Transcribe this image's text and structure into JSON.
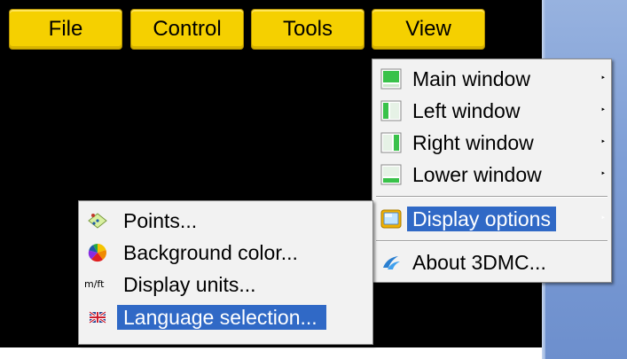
{
  "menubar": {
    "items": [
      {
        "label": "File"
      },
      {
        "label": "Control"
      },
      {
        "label": "Tools"
      },
      {
        "label": "View"
      }
    ]
  },
  "view_menu": {
    "items": [
      {
        "label": "Main window",
        "icon": "main-window-layout-icon",
        "submenu": true
      },
      {
        "label": "Left window",
        "icon": "left-window-layout-icon",
        "submenu": true
      },
      {
        "label": "Right window",
        "icon": "right-window-layout-icon",
        "submenu": true
      },
      {
        "label": "Lower window",
        "icon": "lower-window-layout-icon",
        "submenu": true
      },
      {
        "label": "Display options",
        "icon": "display-options-icon",
        "submenu": true,
        "highlighted": true
      },
      {
        "label": "About 3DMC...",
        "icon": "3dmc-logo-icon",
        "submenu": false
      }
    ],
    "submenu_arrow": "‣"
  },
  "display_options_menu": {
    "items": [
      {
        "label": "Points...",
        "icon": "points-icon"
      },
      {
        "label": "Background color...",
        "icon": "color-wheel-icon"
      },
      {
        "label": "Display units...",
        "icon": "units-icon",
        "icon_text": "m/ft"
      },
      {
        "label": "Language selection...",
        "icon": "uk-flag-icon",
        "highlighted": true
      }
    ]
  },
  "colors": {
    "menubar_yellow": "#f5d000",
    "highlight_blue": "#3069c6",
    "menu_bg": "#f2f2f2",
    "icon_green": "#39c24a",
    "side_panel_blue": "#7e9ed6"
  }
}
